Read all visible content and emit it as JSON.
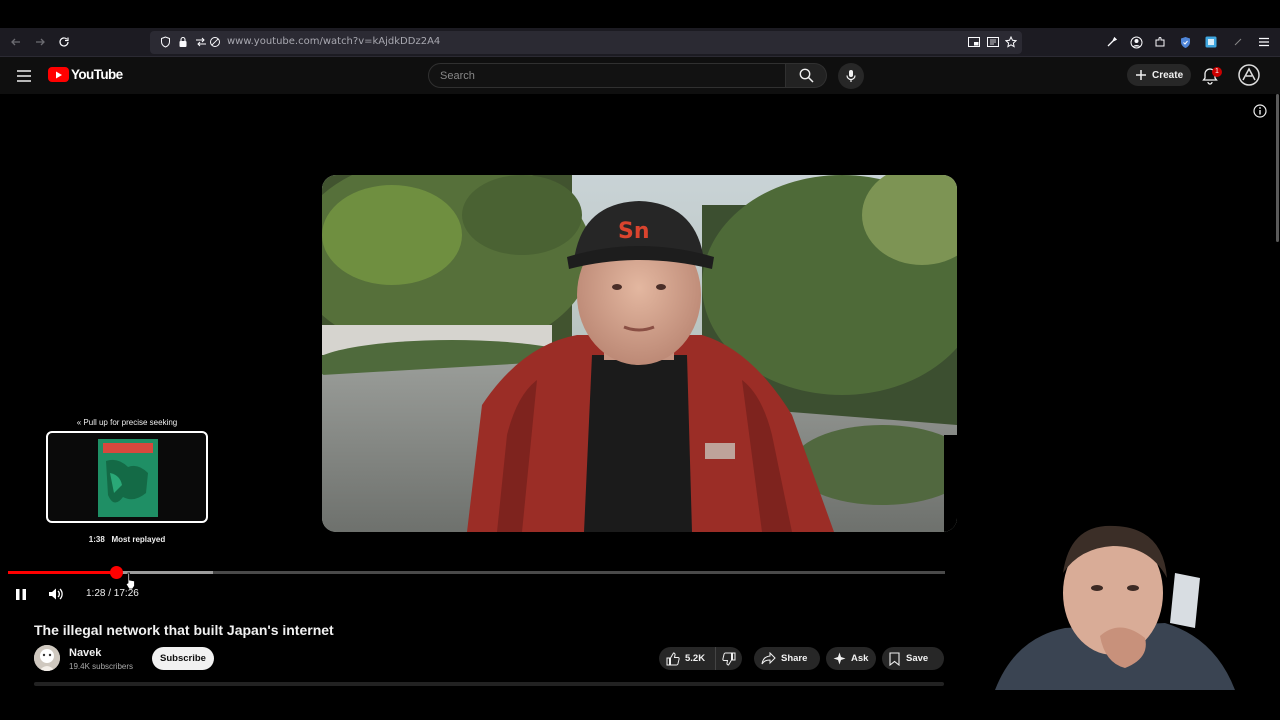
{
  "browser": {
    "url": "www.youtube.com/watch?v=kAjdkDDz2A4"
  },
  "youtube": {
    "logo_text": "YouTube",
    "search_placeholder": "Search",
    "create_label": "Create",
    "notification_count": "1"
  },
  "player": {
    "seek_hint": "Pull up for precise seeking",
    "preview_timestamp": "1:38",
    "preview_label": "Most replayed",
    "current_time": "1:28",
    "duration": "17:26",
    "time_display": "1:28 / 17:26",
    "played_fraction": 0.115,
    "buffered_fraction": 0.219
  },
  "video": {
    "title": "The illegal network that built Japan's internet",
    "channel_name": "Navek",
    "subscribers": "19.4K subscribers",
    "subscribe_label": "Subscribe",
    "likes": "5.2K",
    "share_label": "Share",
    "ask_label": "Ask",
    "save_label": "Save"
  },
  "colors": {
    "accent": "#ff0000",
    "background": "#0f0f0f",
    "pill": "#272727"
  }
}
